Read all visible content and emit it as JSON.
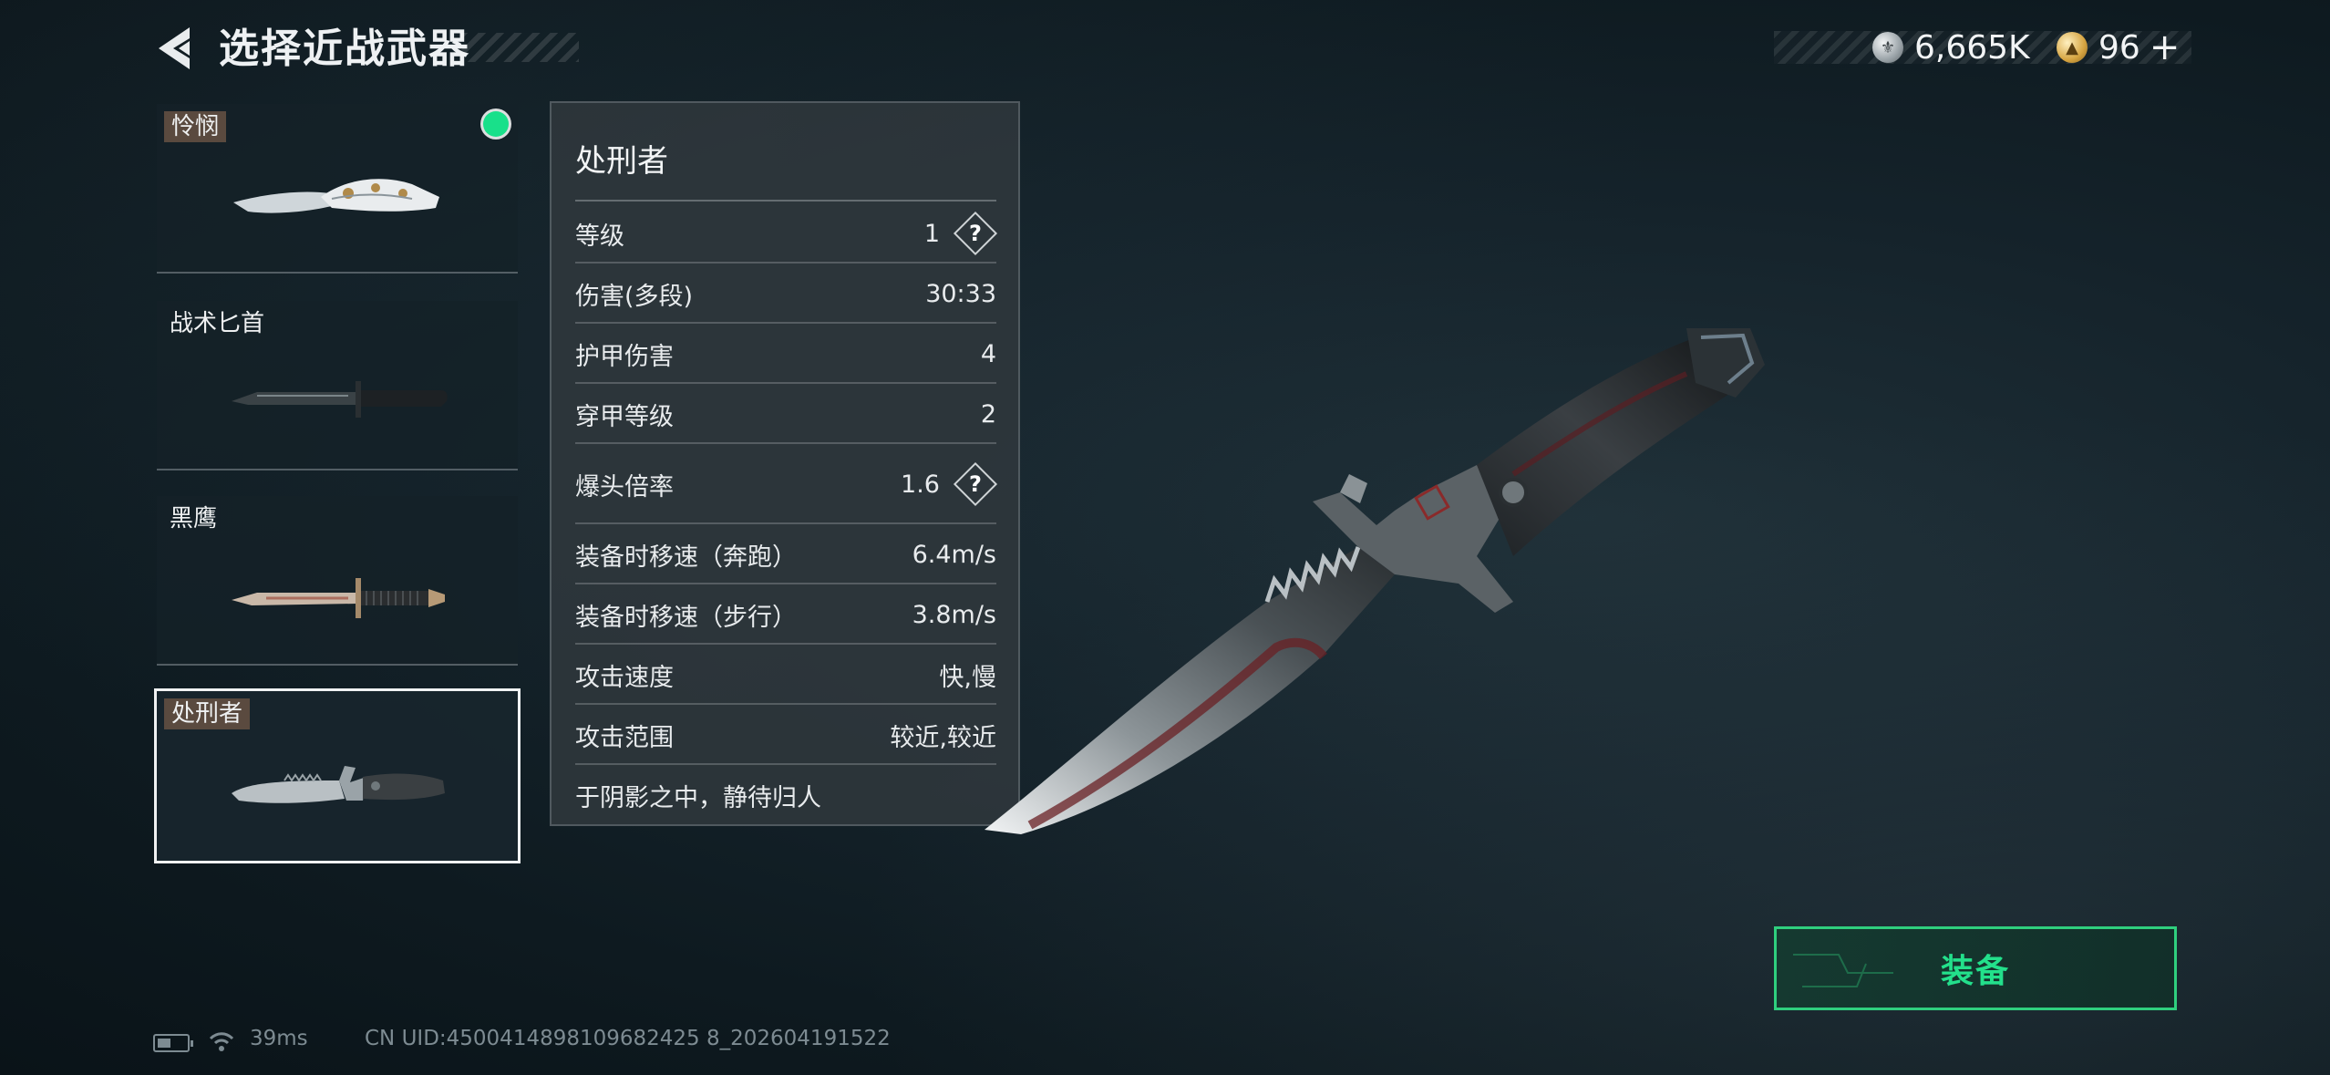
{
  "header": {
    "title": "选择近战武器",
    "currency_silver": "6,665K",
    "currency_gold": "96",
    "plus": "+"
  },
  "weapons": [
    {
      "name": "怜悯",
      "equipped": true,
      "selected": false
    },
    {
      "name": "战术匕首",
      "equipped": false,
      "selected": false
    },
    {
      "name": "黑鹰",
      "equipped": false,
      "selected": false
    },
    {
      "name": "处刑者",
      "equipped": false,
      "selected": true
    }
  ],
  "stats": {
    "title": "处刑者",
    "rows": [
      {
        "label": "等级",
        "value": "1",
        "help": "?"
      },
      {
        "label": "伤害(多段)",
        "value": "30:33"
      },
      {
        "label": "护甲伤害",
        "value": "4"
      },
      {
        "label": "穿甲等级",
        "value": "2"
      },
      {
        "label": "爆头倍率",
        "value": "1.6",
        "help": "?"
      },
      {
        "label": "装备时移速（奔跑）",
        "value": "6.4m/s"
      },
      {
        "label": "装备时移速（步行）",
        "value": "3.8m/s"
      },
      {
        "label": "攻击速度",
        "value": "快,慢"
      },
      {
        "label": "攻击范围",
        "value": "较近,较近"
      }
    ],
    "description": "于阴影之中，静待归人"
  },
  "equip_button": {
    "label": "装备"
  },
  "status_bar": {
    "ping": "39ms",
    "uid": "CN UID:4500414898109682425 8_202604191522"
  },
  "colors": {
    "accent_green": "#23e08b",
    "equipped_dot": "#19e08a",
    "background": "#15232b"
  },
  "icons": [
    "back-arrow-icon",
    "silver-coin-icon",
    "gold-coin-icon",
    "question-icon",
    "battery-icon",
    "wifi-icon"
  ]
}
